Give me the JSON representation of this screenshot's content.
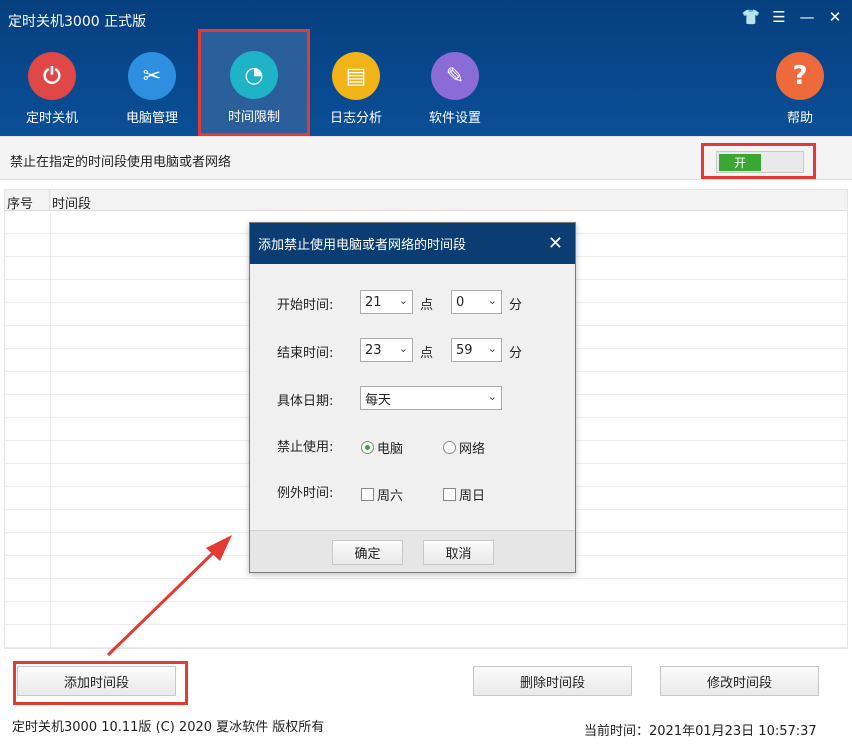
{
  "app_title": "定时关机3000 正式版",
  "window_controls": [
    "shirt-icon",
    "menu-icon",
    "minimize-icon",
    "close-icon"
  ],
  "nav": [
    {
      "label": "定时关机",
      "icon": "power-icon",
      "color": "#e04848",
      "glyph": "⏻"
    },
    {
      "label": "电脑管理",
      "icon": "tools-icon",
      "color": "#2e8fe0",
      "glyph": "✂"
    },
    {
      "label": "时间限制",
      "icon": "timer-icon",
      "color": "#1fb3c7",
      "glyph": "◔",
      "active": true
    },
    {
      "label": "日志分析",
      "icon": "log-icon",
      "color": "#f2b318",
      "glyph": "▤"
    },
    {
      "label": "软件设置",
      "icon": "settings-tools-icon",
      "color": "#8a6bd8",
      "glyph": "✎"
    },
    {
      "label": "帮助",
      "icon": "help-icon",
      "color": "#ef6a3a",
      "glyph": "?"
    }
  ],
  "toolbar": {
    "label": "禁止在指定的时间段使用电脑或者网络",
    "toggle_on": "开"
  },
  "table": {
    "col1": "序号",
    "col2": "时间段"
  },
  "buttons": {
    "add": "添加时间段",
    "delete": "删除时间段",
    "modify": "修改时间段"
  },
  "status": {
    "left": "定时关机3000 10.11版 (C) 2020  夏冰软件 版权所有",
    "right": "当前时间：2021年01月23日 10:57:37"
  },
  "dialog": {
    "title": "添加禁止使用电脑或者网络的时间段",
    "start_label": "开始时间:",
    "start_hour": "21",
    "start_min": "0",
    "end_label": "结束时间:",
    "end_hour": "23",
    "end_min": "59",
    "hour_unit": "点",
    "min_unit": "分",
    "date_label": "具体日期:",
    "date_value": "每天",
    "forbid_label": "禁止使用:",
    "forbid_pc": "电脑",
    "forbid_net": "网络",
    "except_label": "例外时间:",
    "sat": "周六",
    "sun": "周日",
    "ok": "确定",
    "cancel": "取消"
  }
}
